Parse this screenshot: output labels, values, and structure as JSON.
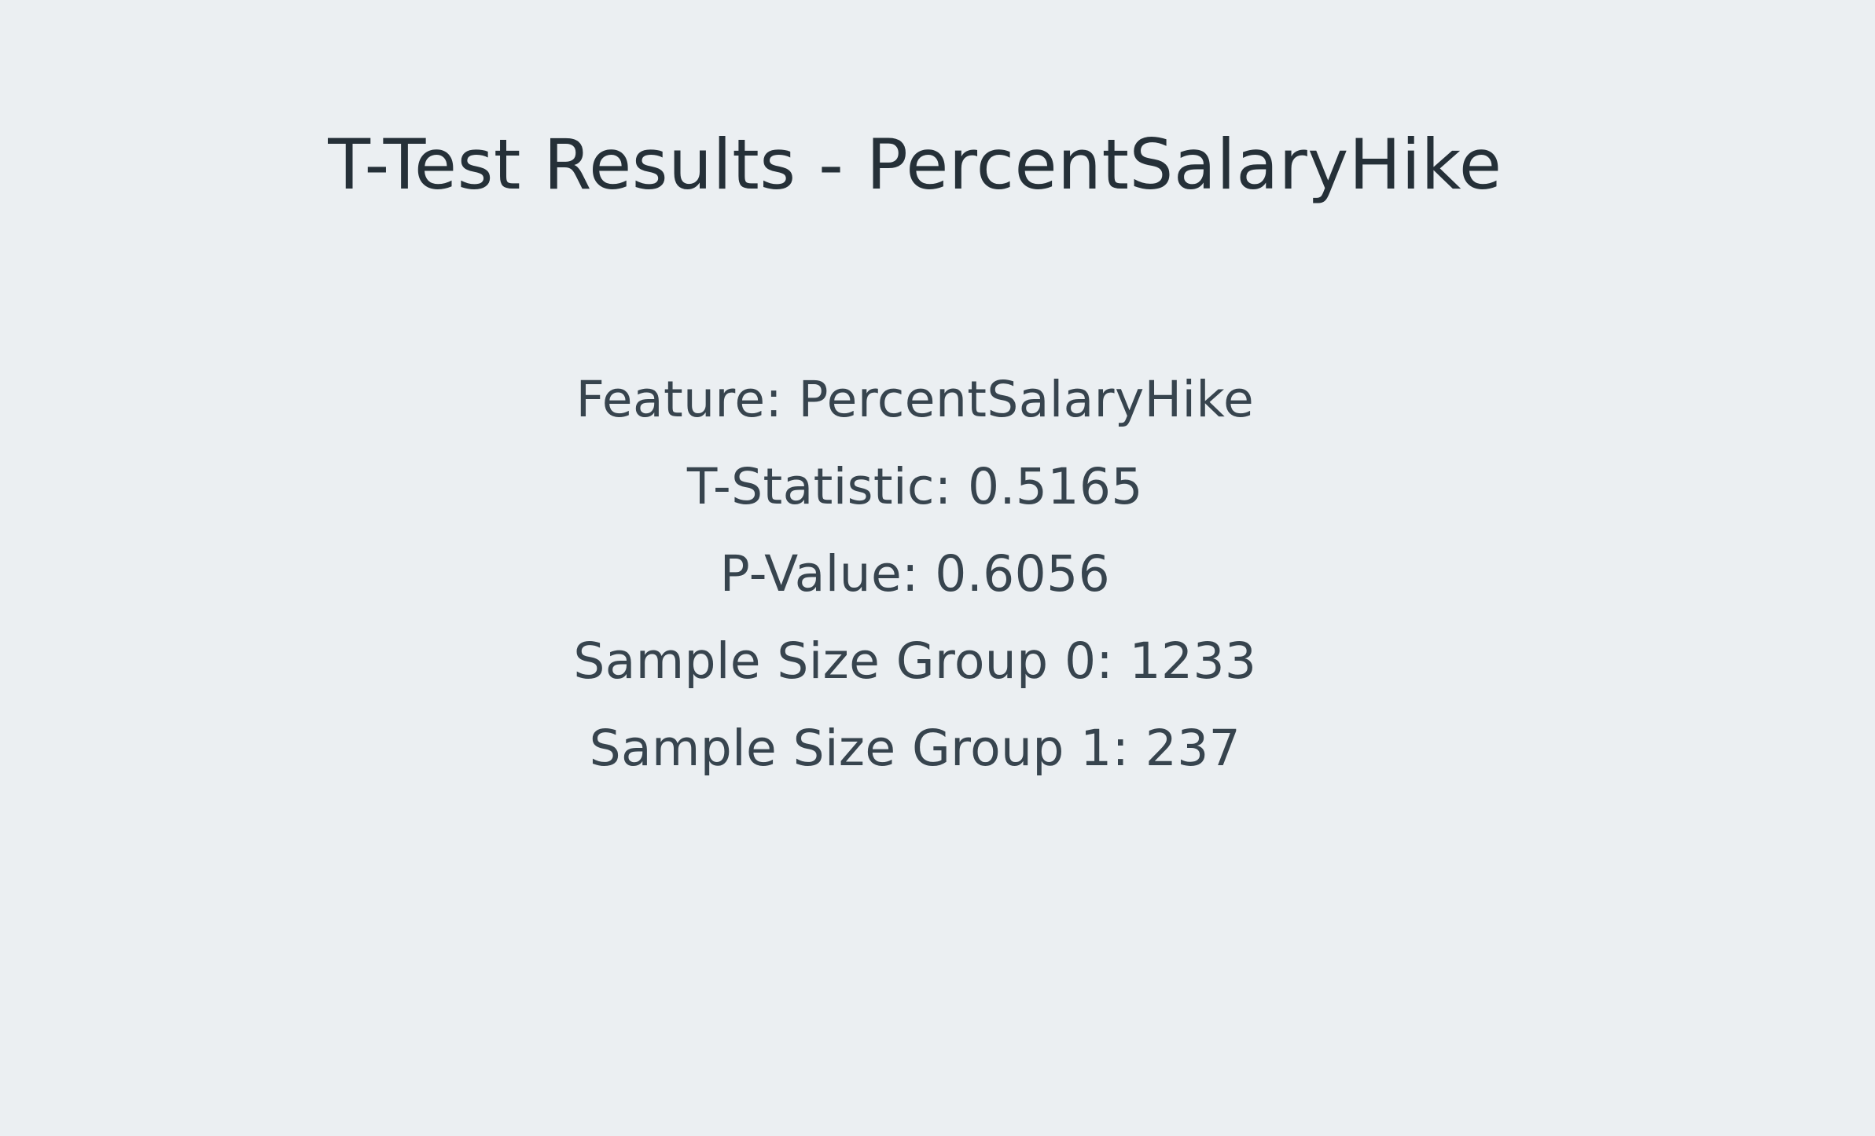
{
  "title": "T-Test Results - PercentSalaryHike",
  "results": [
    "Feature: PercentSalaryHike",
    "T-Statistic: 0.5165",
    "P-Value: 0.6056",
    "Sample Size Group 0: 1233",
    "Sample Size Group 1: 237"
  ],
  "colors": {
    "background": "#ebeff2",
    "title_text": "#253038",
    "body_text": "#37444e"
  }
}
